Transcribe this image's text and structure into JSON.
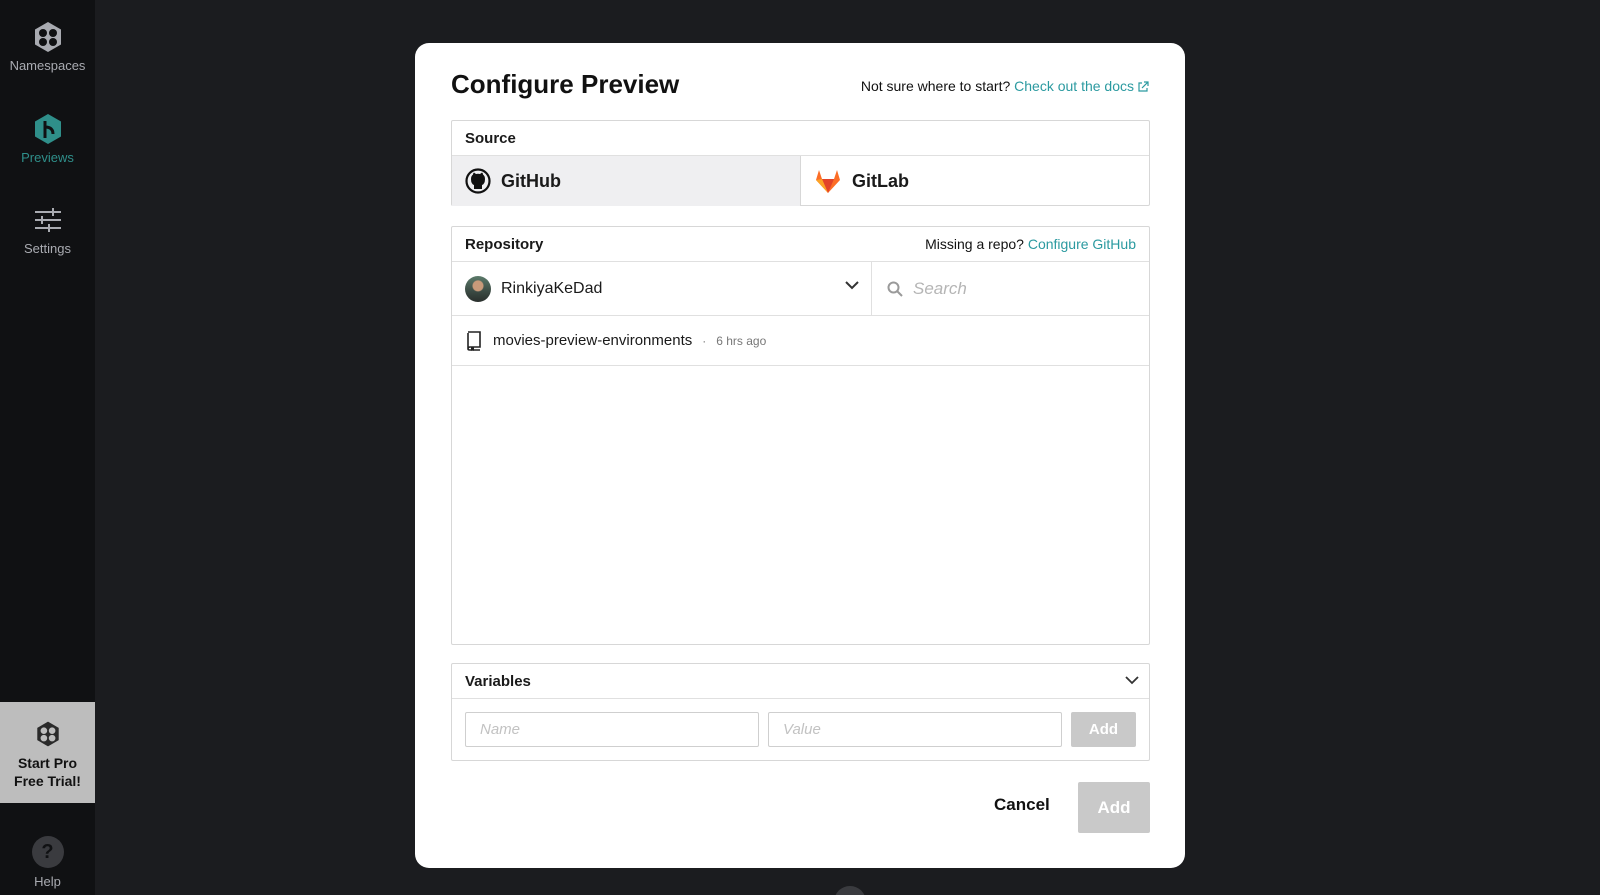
{
  "sidebar": {
    "items": [
      {
        "label": "Namespaces",
        "icon": "namespaces-icon"
      },
      {
        "label": "Previews",
        "icon": "previews-icon",
        "active": true
      },
      {
        "label": "Settings",
        "icon": "settings-sliders-icon"
      }
    ],
    "promo": {
      "line1": "Start Pro",
      "line2": "Free Trial!"
    },
    "help": {
      "label": "Help",
      "glyph": "?"
    }
  },
  "modal": {
    "title": "Configure Preview",
    "docs_prefix": "Not sure where to start?",
    "docs_link": "Check out the docs",
    "source": {
      "heading": "Source",
      "options": [
        {
          "label": "GitHub",
          "icon": "github-icon",
          "selected": true
        },
        {
          "label": "GitLab",
          "icon": "gitlab-icon",
          "selected": false
        }
      ]
    },
    "repository": {
      "heading": "Repository",
      "missing_prefix": "Missing a repo?",
      "missing_link": "Configure GitHub",
      "owner": "RinkiyaKeDad",
      "search_placeholder": "Search",
      "repos": [
        {
          "name": "movies-preview-environments",
          "separator": "·",
          "updated": "6 hrs ago"
        }
      ]
    },
    "variables": {
      "heading": "Variables",
      "name_placeholder": "Name",
      "value_placeholder": "Value",
      "add_label": "Add"
    },
    "cancel_label": "Cancel",
    "add_label": "Add"
  },
  "colors": {
    "accent": "#2b9aa0",
    "disabled": "#c9c9c9",
    "sidebar_bg": "#101113",
    "backdrop": "#1b1c1f"
  }
}
